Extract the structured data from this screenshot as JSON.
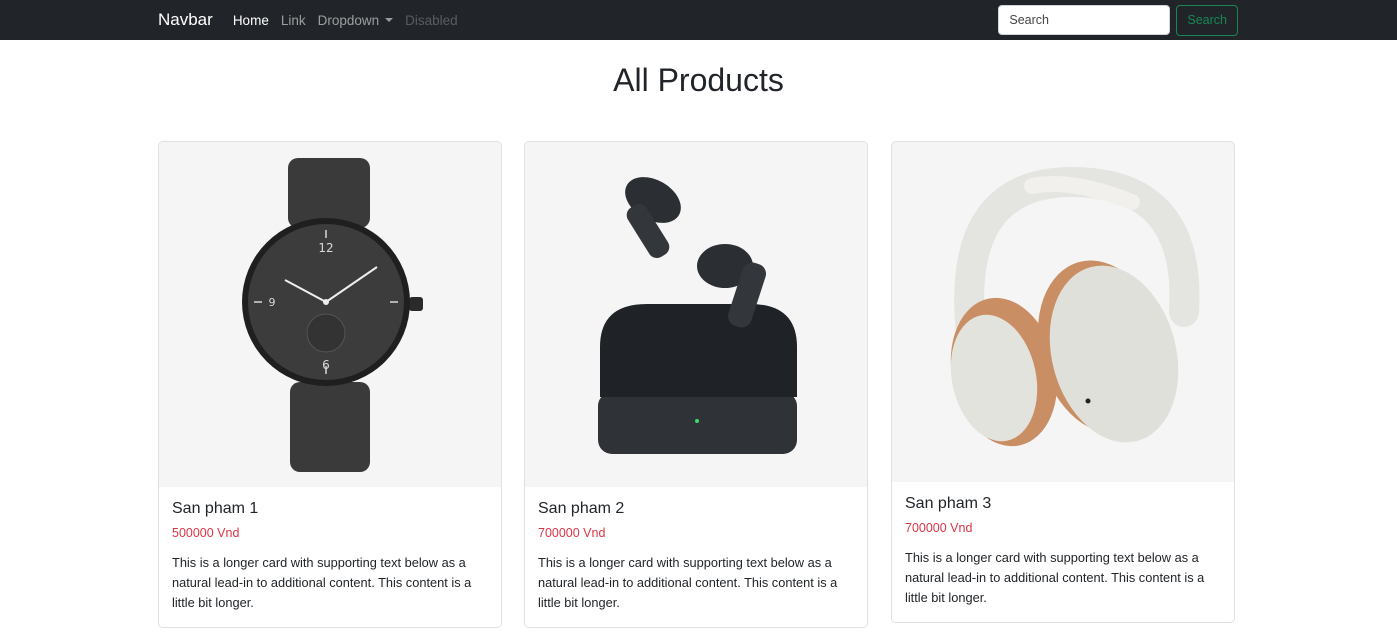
{
  "navbar": {
    "brand": "Navbar",
    "links": [
      {
        "label": "Home"
      },
      {
        "label": "Link"
      },
      {
        "label": "Dropdown"
      },
      {
        "label": "Disabled"
      }
    ],
    "search": {
      "placeholder": "Search",
      "button_label": "Search"
    }
  },
  "page": {
    "title": "All Products"
  },
  "products": [
    {
      "name": "San pham 1",
      "price": "500000 Vnd",
      "description": "This is a longer card with supporting text below as a natural lead-in to additional content. This content is a little bit longer.",
      "image_icon": "watch-icon"
    },
    {
      "name": "San pham 2",
      "price": "700000 Vnd",
      "description": "This is a longer card with supporting text below as a natural lead-in to additional content. This content is a little bit longer.",
      "image_icon": "earbuds-icon"
    },
    {
      "name": "San pham 3",
      "price": "700000 Vnd",
      "description": "This is a longer card with supporting text below as a natural lead-in to additional content. This content is a little bit longer.",
      "image_icon": "headphones-icon"
    }
  ],
  "colors": {
    "navbar_bg": "#212529",
    "price": "#dc3545",
    "search_button": "#198754"
  }
}
